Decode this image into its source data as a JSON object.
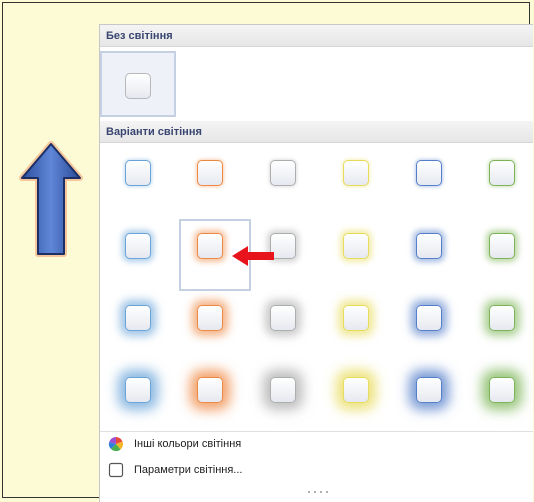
{
  "no_glow": {
    "header": "Без світіння"
  },
  "glow_variants": {
    "header": "Варіанти світіння",
    "selected": {
      "row": 2,
      "col": 2
    },
    "column_colors": [
      "#5b9bd5",
      "#ed7d31",
      "#a5a5a5",
      "#e6d84a",
      "#4472c4",
      "#70ad47"
    ],
    "rows": 4
  },
  "menu": {
    "more_colors_label": "Інші кольори світіння",
    "options_label": "Параметри світіння..."
  },
  "icons": {
    "blue_arrow": "up-arrow-icon",
    "red_arrow": "left-arrow-icon"
  }
}
